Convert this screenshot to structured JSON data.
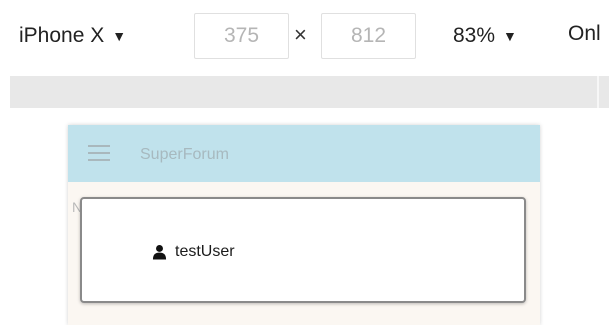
{
  "toolbar": {
    "device_label": "iPhone X",
    "device_icon": "caret-down-icon",
    "width_value": "375",
    "times_symbol": "×",
    "height_value": "812",
    "zoom_label": "83%",
    "zoom_icon": "caret-down-icon",
    "throttle_label": "Onl"
  },
  "app": {
    "brand": "SuperForum",
    "side_letter": "N",
    "menu_icon": "hamburger-icon",
    "user": {
      "icon": "user-icon",
      "name": "testUser"
    }
  },
  "colors": {
    "nav_background": "#c0e2ec",
    "page_background": "#fbf7f2",
    "card_border": "#8a8a8a"
  }
}
